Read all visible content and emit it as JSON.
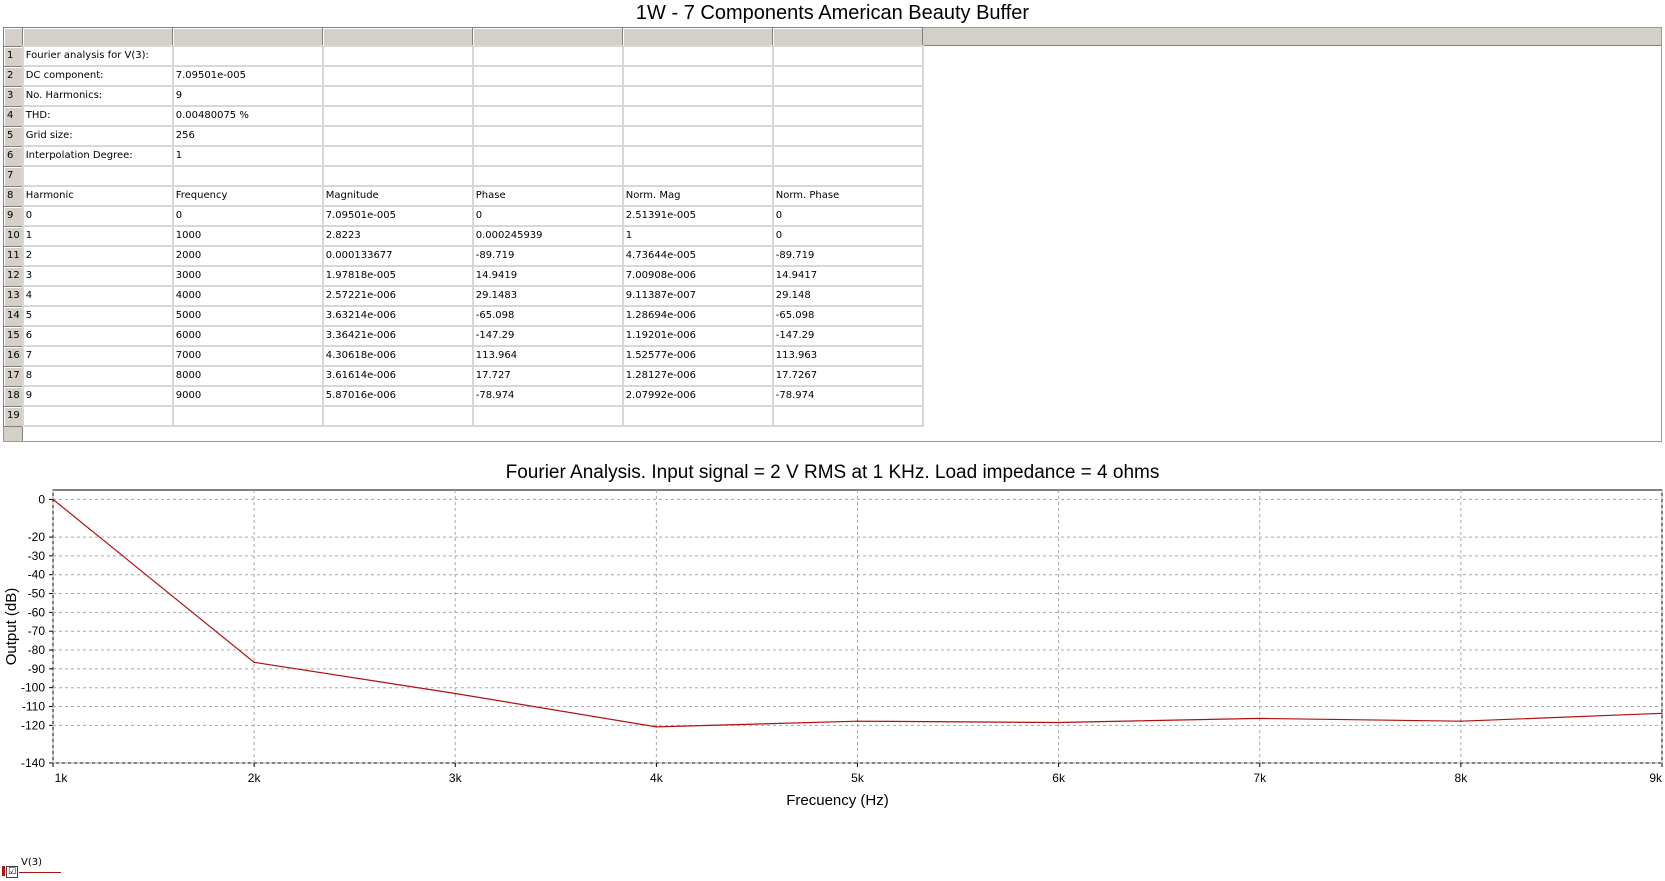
{
  "window_title": "1W - 7 Components American Beauty Buffer",
  "table": {
    "row_numbers": [
      "1",
      "2",
      "3",
      "4",
      "5",
      "6",
      "7",
      "8",
      "9",
      "10",
      "11",
      "12",
      "13",
      "14",
      "15",
      "16",
      "17",
      "18",
      "19"
    ],
    "rows": [
      [
        "Fourier analysis for V(3):",
        "",
        "",
        "",
        "",
        ""
      ],
      [
        "DC component:",
        "7.09501e-005",
        "",
        "",
        "",
        ""
      ],
      [
        "No. Harmonics:",
        "9",
        "",
        "",
        "",
        ""
      ],
      [
        "THD:",
        "0.00480075 %",
        "",
        "",
        "",
        ""
      ],
      [
        "Grid size:",
        "256",
        "",
        "",
        "",
        ""
      ],
      [
        "Interpolation Degree:",
        "1",
        "",
        "",
        "",
        ""
      ],
      [
        "",
        "",
        "",
        "",
        "",
        ""
      ],
      [
        "Harmonic",
        "Frequency",
        "Magnitude",
        "Phase",
        "Norm. Mag",
        "Norm. Phase"
      ],
      [
        "0",
        "0",
        "7.09501e-005",
        "0",
        "2.51391e-005",
        "0"
      ],
      [
        "1",
        "1000",
        "2.8223",
        "0.000245939",
        "1",
        "0"
      ],
      [
        "2",
        "2000",
        "0.000133677",
        "-89.719",
        "4.73644e-005",
        "-89.719"
      ],
      [
        "3",
        "3000",
        "1.97818e-005",
        "14.9419",
        "7.00908e-006",
        "14.9417"
      ],
      [
        "4",
        "4000",
        "2.57221e-006",
        "29.1483",
        "9.11387e-007",
        "29.148"
      ],
      [
        "5",
        "5000",
        "3.63214e-006",
        "-65.098",
        "1.28694e-006",
        "-65.098"
      ],
      [
        "6",
        "6000",
        "3.36421e-006",
        "-147.29",
        "1.19201e-006",
        "-147.29"
      ],
      [
        "7",
        "7000",
        "4.30618e-006",
        "113.964",
        "1.52577e-006",
        "113.963"
      ],
      [
        "8",
        "8000",
        "3.61614e-006",
        "17.727",
        "1.28127e-006",
        "17.7267"
      ],
      [
        "9",
        "9000",
        "5.87016e-006",
        "-78.974",
        "2.07992e-006",
        "-78.974"
      ],
      [
        "",
        "",
        "",
        "",
        "",
        ""
      ]
    ]
  },
  "legend": {
    "label": "V(3)",
    "checked": true
  },
  "chart_data": {
    "type": "line",
    "title": "Fourier Analysis. Input signal = 2 V RMS at 1 KHz. Load impedance = 4 ohms",
    "xlabel": "Frecuency (Hz)",
    "ylabel": "Output (dB)",
    "xlim": [
      1000,
      9000
    ],
    "ylim": [
      -140,
      5
    ],
    "x_ticks": [
      1000,
      2000,
      3000,
      4000,
      5000,
      6000,
      7000,
      8000,
      9000
    ],
    "x_tick_labels": [
      "1k",
      "2k",
      "3k",
      "4k",
      "5k",
      "6k",
      "7k",
      "8k",
      "9k"
    ],
    "y_ticks": [
      0,
      -20,
      -30,
      -40,
      -50,
      -60,
      -70,
      -80,
      -90,
      -100,
      -110,
      -120,
      -140
    ],
    "y_tick_labels": [
      "0",
      "-20",
      "-30",
      "-40",
      "-50",
      "-60",
      "-70",
      "-80",
      "-90",
      "-100",
      "-110",
      "-120",
      "-140"
    ],
    "grid": true,
    "series": [
      {
        "name": "V(3)",
        "color": "#b01010",
        "x": [
          1000,
          2000,
          3000,
          4000,
          5000,
          6000,
          7000,
          8000,
          9000
        ],
        "y": [
          0,
          -86.5,
          -103.1,
          -120.8,
          -117.8,
          -118.5,
          -116.3,
          -117.8,
          -113.6
        ]
      }
    ]
  }
}
